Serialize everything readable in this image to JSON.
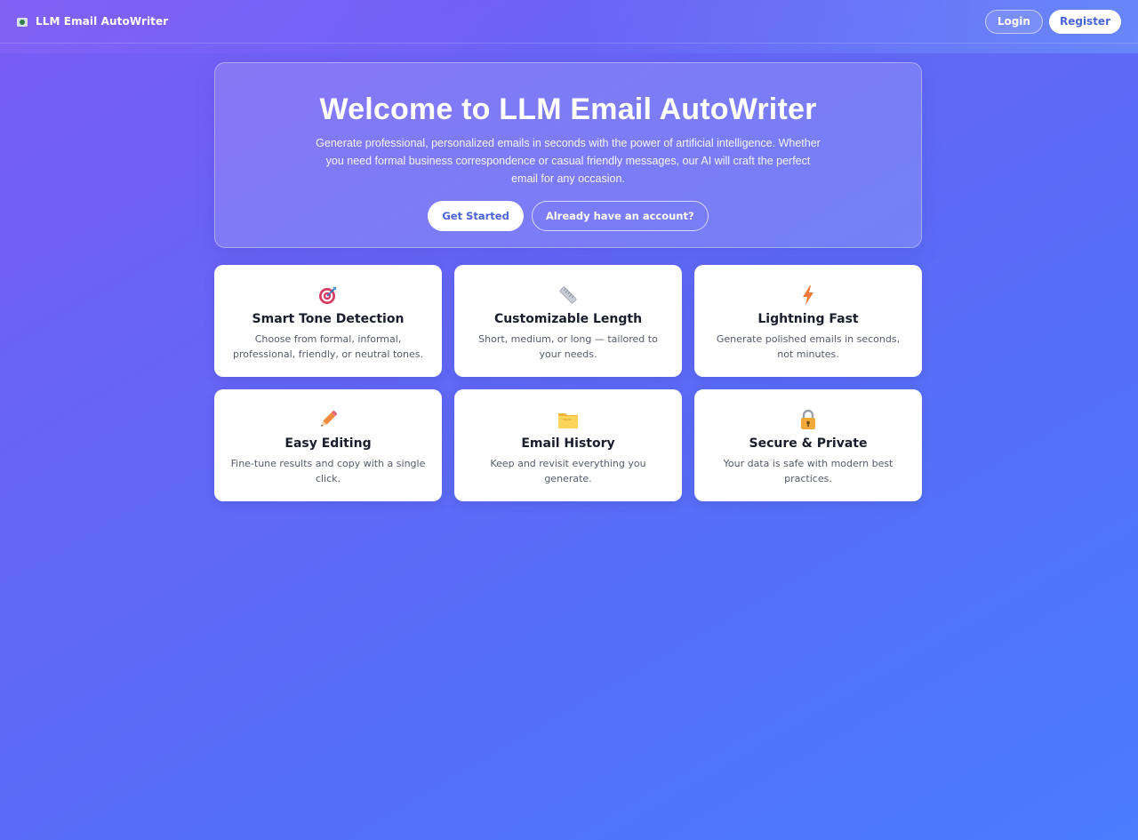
{
  "nav": {
    "brand": "LLM Email AutoWriter",
    "brand_icon": "email-app-icon",
    "login_label": "Login",
    "register_label": "Register"
  },
  "hero": {
    "title": "Welcome to LLM Email AutoWriter",
    "description": "Generate professional, personalized emails in seconds with the power of artificial intelligence. Whether you need formal business correspondence or casual friendly messages, our AI will craft the perfect email for any occasion.",
    "primary_label": "Get Started",
    "secondary_label": "Already have an account?"
  },
  "features": [
    {
      "icon": "target-icon",
      "title": "Smart Tone Detection",
      "description": "Choose from formal, informal, professional, friendly, or neutral tones."
    },
    {
      "icon": "ruler-icon",
      "title": "Customizable Length",
      "description": "Short, medium, or long — tailored to your needs."
    },
    {
      "icon": "lightning-icon",
      "title": "Lightning Fast",
      "description": "Generate polished emails in seconds, not minutes."
    },
    {
      "icon": "pencil-icon",
      "title": "Easy Editing",
      "description": "Fine-tune results and copy with a single click."
    },
    {
      "icon": "folder-icon",
      "title": "Email History",
      "description": "Keep and revisit everything you generate."
    },
    {
      "icon": "lock-icon",
      "title": "Secure & Private",
      "description": "Your data is safe with modern best practices."
    }
  ],
  "colors": {
    "accent": "#4a63d6",
    "gradient_start": "#7a5cf3",
    "gradient_end": "#4a7cfd"
  }
}
